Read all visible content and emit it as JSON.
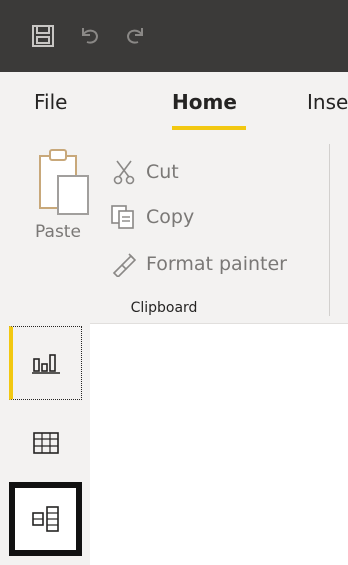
{
  "title_bar": {
    "save_icon": "save-icon",
    "undo_icon": "undo-icon",
    "redo_icon": "redo-icon"
  },
  "tabs": [
    {
      "label": "File"
    },
    {
      "label": "Home",
      "active": true
    },
    {
      "label": "Inse"
    }
  ],
  "clipboard": {
    "paste_label": "Paste",
    "cut_label": "Cut",
    "copy_label": "Copy",
    "format_painter_label": "Format painter",
    "group_label": "Clipboard"
  },
  "views": [
    {
      "name": "report-view",
      "icon": "bar-chart-icon",
      "active": true
    },
    {
      "name": "data-view",
      "icon": "table-icon"
    },
    {
      "name": "model-view",
      "icon": "model-icon"
    }
  ],
  "colors": {
    "accent": "#f2c811",
    "titlebar": "#3b3a39",
    "ribbon": "#f3f2f1"
  }
}
